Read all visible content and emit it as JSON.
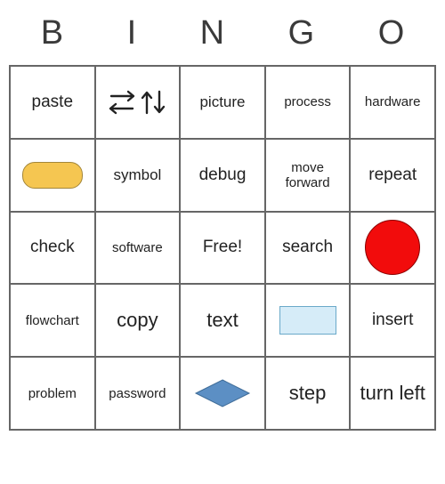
{
  "header": [
    "B",
    "I",
    "N",
    "G",
    "O"
  ],
  "grid": [
    [
      {
        "type": "text",
        "value": "paste"
      },
      {
        "type": "shape",
        "shape": "arrows"
      },
      {
        "type": "text",
        "value": "picture",
        "size": "md"
      },
      {
        "type": "text",
        "value": "process",
        "size": "sm"
      },
      {
        "type": "text",
        "value": "hardware",
        "size": "sm"
      }
    ],
    [
      {
        "type": "shape",
        "shape": "oval"
      },
      {
        "type": "text",
        "value": "symbol",
        "size": "md"
      },
      {
        "type": "text",
        "value": "debug"
      },
      {
        "type": "text",
        "value": "move forward",
        "size": "sm"
      },
      {
        "type": "text",
        "value": "repeat"
      }
    ],
    [
      {
        "type": "text",
        "value": "check"
      },
      {
        "type": "text",
        "value": "software",
        "size": "sm"
      },
      {
        "type": "text",
        "value": "Free!"
      },
      {
        "type": "text",
        "value": "search"
      },
      {
        "type": "shape",
        "shape": "circle"
      }
    ],
    [
      {
        "type": "text",
        "value": "flowchart",
        "size": "sm"
      },
      {
        "type": "text",
        "value": "copy",
        "size": "lg"
      },
      {
        "type": "text",
        "value": "text",
        "size": "lg"
      },
      {
        "type": "shape",
        "shape": "rect"
      },
      {
        "type": "text",
        "value": "insert"
      }
    ],
    [
      {
        "type": "text",
        "value": "problem",
        "size": "sm"
      },
      {
        "type": "text",
        "value": "password",
        "size": "sm"
      },
      {
        "type": "shape",
        "shape": "diamond"
      },
      {
        "type": "text",
        "value": "step",
        "size": "lg"
      },
      {
        "type": "text",
        "value": "turn left",
        "size": "lg"
      }
    ]
  ]
}
